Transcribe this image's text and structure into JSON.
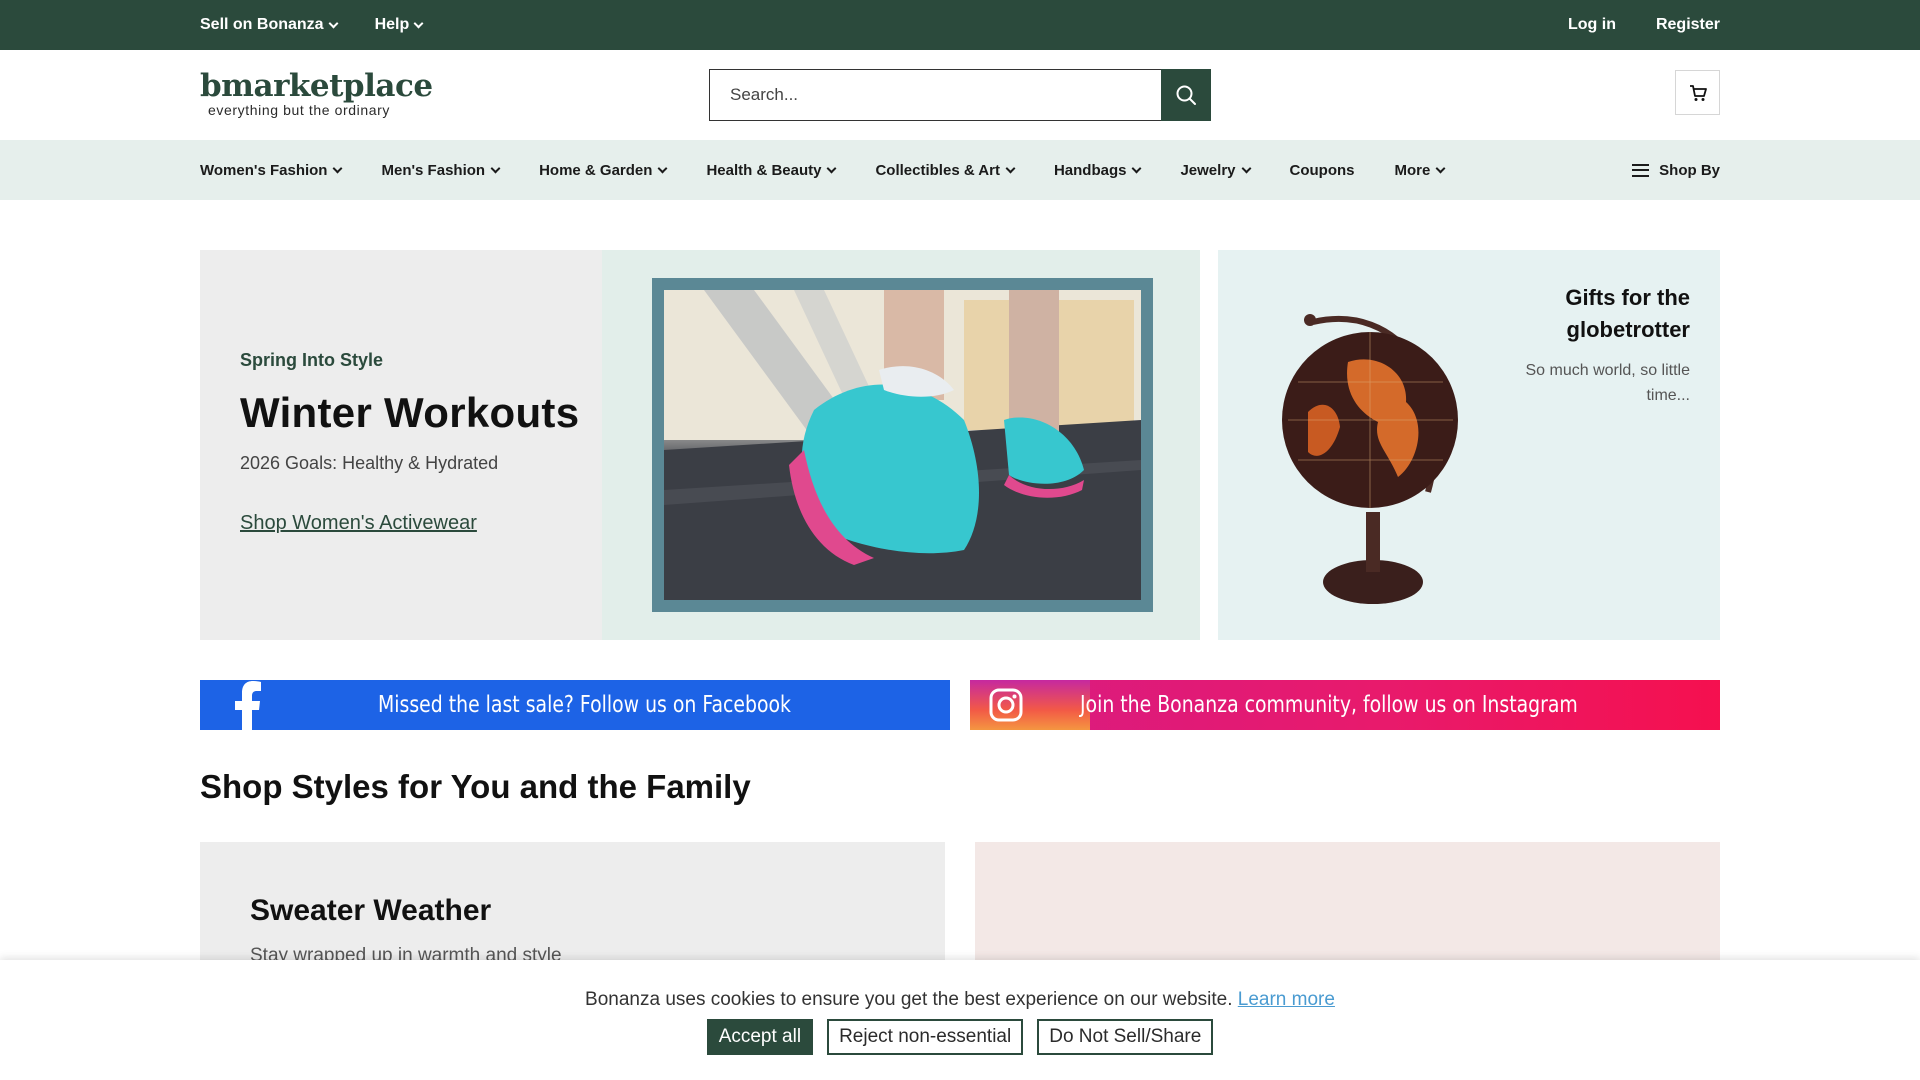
{
  "topbar": {
    "sell_label": "Sell on Bonanza",
    "help_label": "Help",
    "login_label": "Log in",
    "register_label": "Register"
  },
  "header": {
    "logo_main": "bmarketplace",
    "logo_tagline": "everything but the ordinary",
    "search_placeholder": "Search...",
    "search_icon": "search-icon",
    "cart_icon": "cart-icon"
  },
  "nav": {
    "categories": [
      {
        "label": "Women's Fashion",
        "dropdown": true
      },
      {
        "label": "Men's Fashion",
        "dropdown": true
      },
      {
        "label": "Home & Garden",
        "dropdown": true
      },
      {
        "label": "Health & Beauty",
        "dropdown": true
      },
      {
        "label": "Collectibles & Art",
        "dropdown": true
      },
      {
        "label": "Handbags",
        "dropdown": true
      },
      {
        "label": "Jewelry",
        "dropdown": true
      },
      {
        "label": "Coupons",
        "dropdown": false
      },
      {
        "label": "More",
        "dropdown": true
      }
    ],
    "shop_by_label": "Shop By"
  },
  "hero": {
    "eyebrow": "Spring Into Style",
    "title": "Winter Workouts",
    "subtitle": "2026 Goals: Healthy & Hydrated",
    "link": "Shop Women's Activewear"
  },
  "promo": {
    "title": "Gifts for the globetrotter",
    "subtitle": "So much world, so little time..."
  },
  "social": {
    "facebook_text": "Missed the last sale? Follow us on Facebook",
    "instagram_text": "Join the Bonanza community, follow us on Instagram"
  },
  "section": {
    "title": "Shop Styles for You and the Family",
    "card_title": "Sweater Weather",
    "card_subtitle": "Stay wrapped up in warmth and style"
  },
  "cookie": {
    "message": "Bonanza uses cookies to ensure you get the best experience on our website.",
    "learn_more": "Learn more",
    "accept": "Accept all",
    "reject": "Reject non-essential",
    "dns": "Do Not Sell/Share"
  },
  "colors": {
    "brand_green": "#2b4a3c",
    "nav_bg": "#e6efec",
    "facebook_blue": "#1d63e6",
    "instagram_pink": "#e81a6c",
    "link_blue": "#4a9bd1"
  }
}
